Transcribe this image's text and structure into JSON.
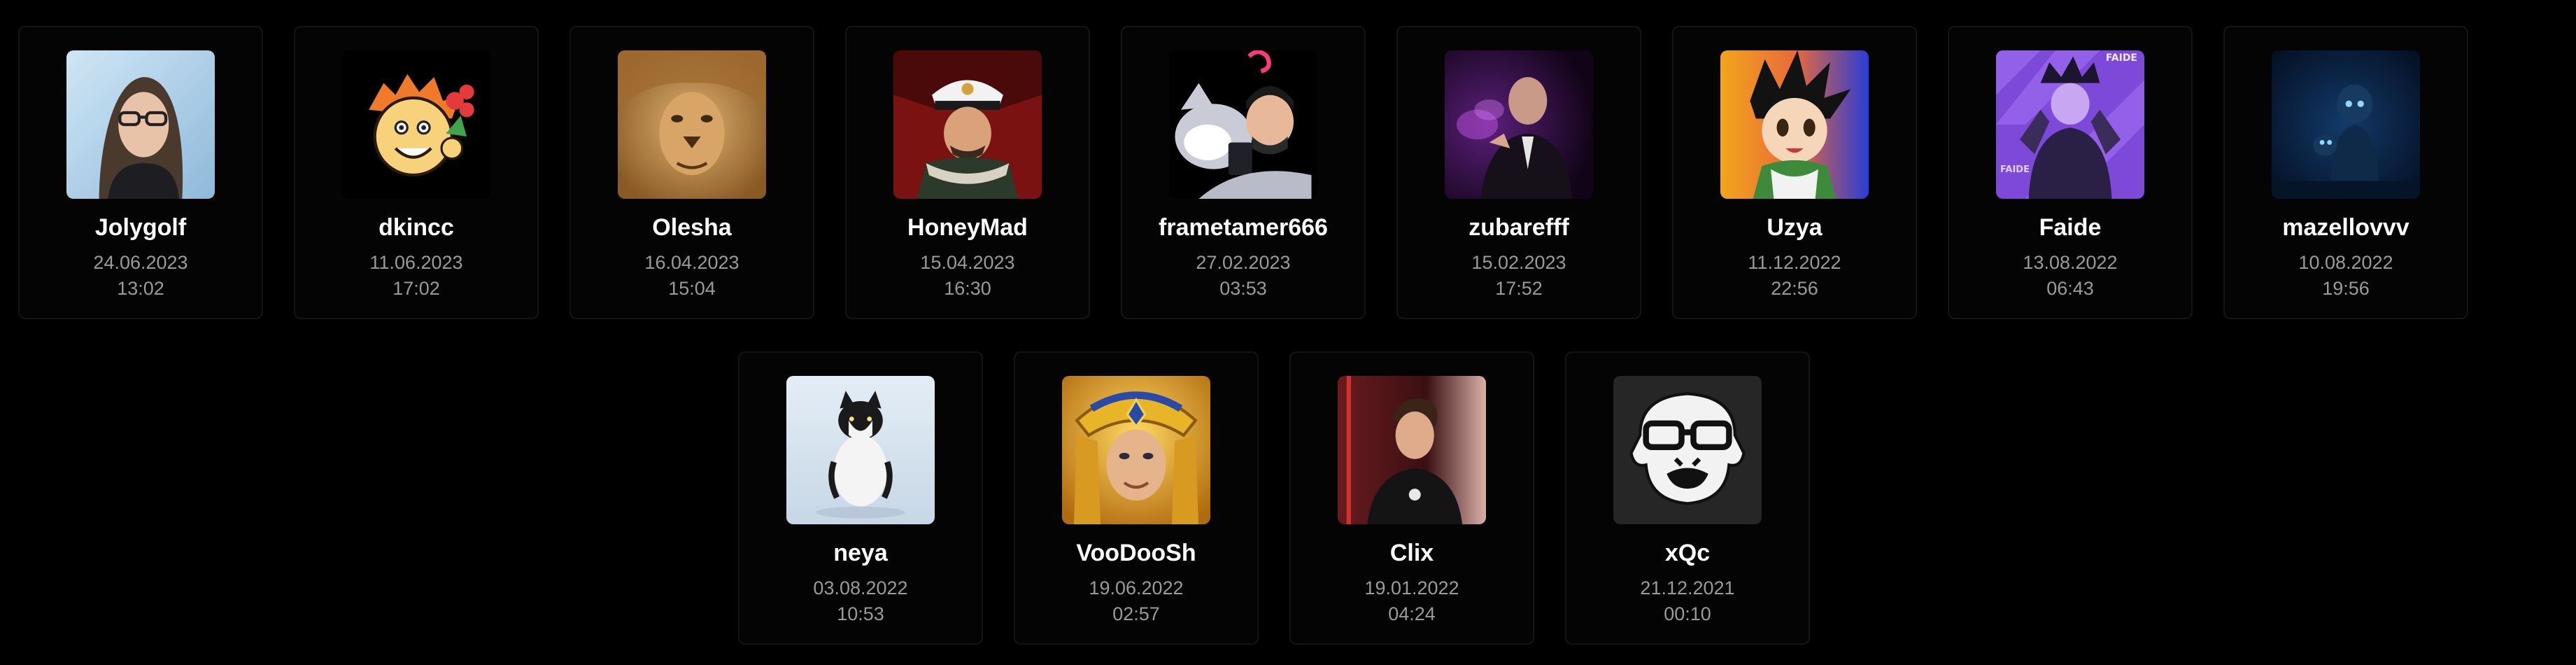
{
  "row1": [
    {
      "name": "Jolygolf",
      "date": "24.06.2023",
      "time": "13:02",
      "avatar": "man-glasses-photo"
    },
    {
      "name": "dkincc",
      "date": "11.06.2023",
      "time": "17:02",
      "avatar": "cartoon-boy-flowers"
    },
    {
      "name": "Olesha",
      "date": "16.04.2023",
      "time": "15:04",
      "avatar": "lion-face"
    },
    {
      "name": "HoneyMad",
      "date": "15.04.2023",
      "time": "16:30",
      "avatar": "captain-portrait"
    },
    {
      "name": "frametamer666",
      "date": "27.02.2023",
      "time": "03:53",
      "avatar": "man-with-husky"
    },
    {
      "name": "zubarefff",
      "date": "15.02.2023",
      "time": "17:52",
      "avatar": "man-purple-smoke"
    },
    {
      "name": "Uzya",
      "date": "11.12.2022",
      "time": "22:56",
      "avatar": "anime-boy"
    },
    {
      "name": "Faide",
      "date": "13.08.2022",
      "time": "06:43",
      "avatar": "purple-gamer",
      "avatar_text": "FAIDE"
    },
    {
      "name": "mazellovvv",
      "date": "10.08.2022",
      "time": "19:56",
      "avatar": "dark-blue-figure"
    }
  ],
  "row2": [
    {
      "name": "neya",
      "date": "03.08.2022",
      "time": "10:53",
      "avatar": "kitten-snow"
    },
    {
      "name": "VooDooSh",
      "date": "19.06.2022",
      "time": "02:57",
      "avatar": "golden-helmet-man"
    },
    {
      "name": "Clix",
      "date": "19.01.2022",
      "time": "04:24",
      "avatar": "young-man-profile"
    },
    {
      "name": "xQc",
      "date": "21.12.2021",
      "time": "00:10",
      "avatar": "gorilla-glasses-logo"
    }
  ]
}
